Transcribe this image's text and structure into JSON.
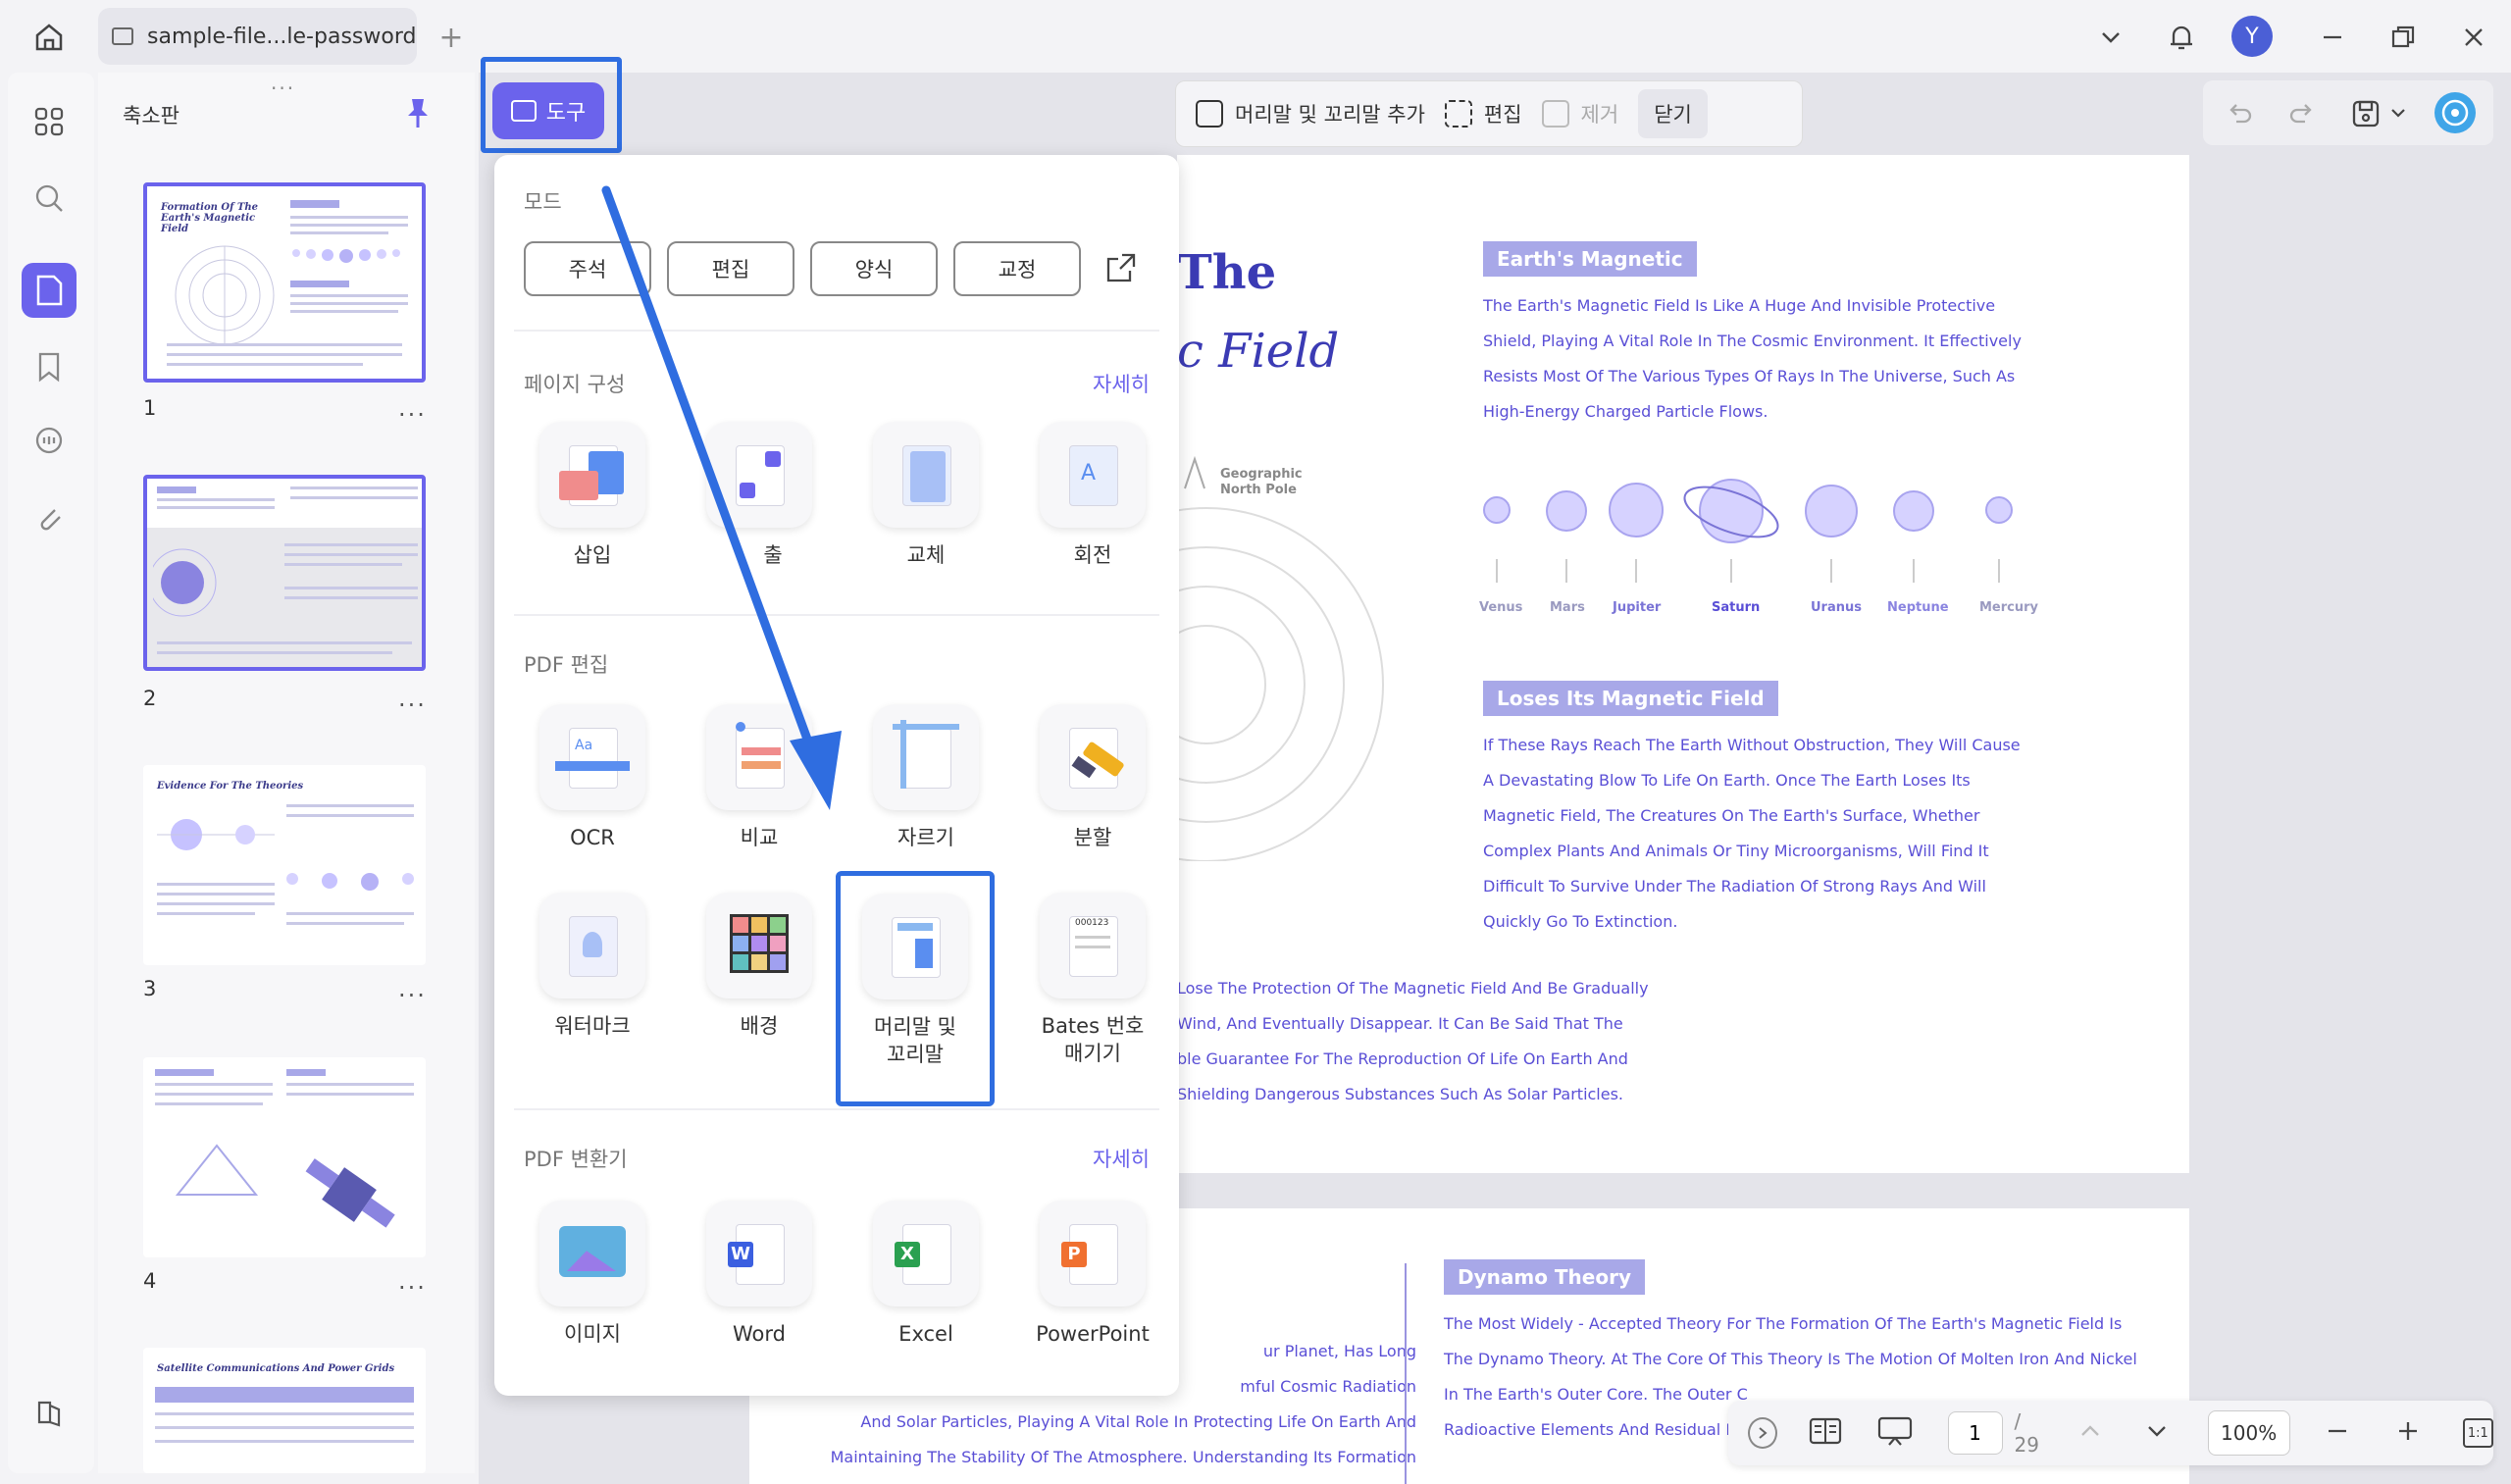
{
  "tab": {
    "title": "sample-file...le-password"
  },
  "user": {
    "initial": "Y"
  },
  "thumbnails": {
    "panel_title": "축소판",
    "pages": [
      {
        "num": "1",
        "title": "Formation Of The Earth's Magnetic Field"
      },
      {
        "num": "2",
        "title": ""
      },
      {
        "num": "3",
        "title": "Evidence For The Theories"
      },
      {
        "num": "4",
        "title": ""
      },
      {
        "num": "",
        "title": "Satellite Communications And Power Grids"
      }
    ],
    "more": "..."
  },
  "toolbar": {
    "tools_label": "도구",
    "header_footer_add": "머리말 및 꼬리말 추가",
    "edit": "편집",
    "remove": "제거",
    "close": "닫기"
  },
  "menu": {
    "mode_title": "모드",
    "modes": [
      "주석",
      "편집",
      "양식",
      "교정"
    ],
    "page_section": "페이지 구성",
    "page_more": "자세히",
    "page_tools": [
      "삽입",
      "추출",
      "교체",
      "회전"
    ],
    "page_tools_visible": [
      "삽입",
      "출",
      "교체",
      "회전"
    ],
    "pdf_edit_section": "PDF 편집",
    "edit_tools_row1": [
      "OCR",
      "비교",
      "자르기",
      "분할"
    ],
    "edit_tools_row2": [
      "워터마크",
      "배경",
      "머리말 및\n꼬리말",
      "Bates 번호\n매기기"
    ],
    "convert_section": "PDF 변환기",
    "convert_more": "자세히",
    "convert_tools": [
      "이미지",
      "Word",
      "Excel",
      "PowerPoint"
    ]
  },
  "document": {
    "title_part1": "The",
    "title_part2": "c Field",
    "geo_pole": "Geographic\nNorth Pole",
    "tag1": "Earth's Magnetic",
    "para1": "The Earth's Magnetic Field Is Like A Huge And Invisible Protective Shield, Playing A Vital Role In The Cosmic Environment. It Effectively Resists Most Of The Various Types Of Rays In The Universe, Such As High-Energy Charged Particle Flows.",
    "planets": [
      "Venus",
      "Mars",
      "Jupiter",
      "Saturn",
      "Uranus",
      "Neptune",
      "Mercury"
    ],
    "tag2": "Loses Its Magnetic Field",
    "para2": "If These Rays Reach The Earth Without Obstruction, They Will Cause A Devastating Blow To Life On Earth. Once The Earth Loses Its Magnetic Field, The Creatures On The Earth's Surface, Whether Complex Plants And Animals Or Tiny Microorganisms, Will Find It Difficult To Survive Under The Radiation Of Strong Rays And Will Quickly Go To Extinction.",
    "para3": "Lose The Protection Of The Magnetic Field And Be Gradually\nWind, And Eventually Disappear. It Can Be Said That The\nble Guarantee For The Reproduction Of Life On Earth And\nShielding Dangerous Substances Such As Solar Particles.",
    "page2_left": "ur Planet, Has Long\nmful Cosmic Radiation\nAnd Solar Particles, Playing A Vital Role In Protecting Life On Earth And\nMaintaining The Stability Of The Atmosphere. Understanding Its Formation",
    "tag3": "Dynamo Theory",
    "para4": "The Most Widely - Accepted Theory For The Formation Of The Earth's Magnetic Field Is\nThe Dynamo Theory. At The Core Of This Theory Is The Motion Of Molten Iron And Nickel\nIn The Earth's Outer Core. The Outer C\nRadioactive Elements And Residual He"
  },
  "status": {
    "page_current": "1",
    "page_total": "/ 29",
    "zoom": "100%"
  },
  "colors": {
    "accent": "#6b63ec",
    "highlight": "#2f6de0"
  }
}
